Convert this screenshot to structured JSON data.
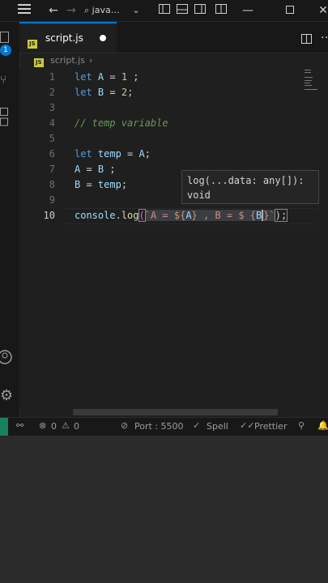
{
  "titlebar": {
    "search_text": "java…"
  },
  "tab": {
    "filename": "script.js",
    "badge": "JS"
  },
  "breadcrumb": {
    "file": "script.js",
    "separator": "›",
    "badge": "JS"
  },
  "editor": {
    "line_numbers": [
      "1",
      "2",
      "3",
      "4",
      "5",
      "6",
      "7",
      "8",
      "9",
      "10"
    ],
    "lines": {
      "l1": {
        "kw": "let",
        "name": "A",
        "op": " = ",
        "num": "1",
        "end": " ;"
      },
      "l2": {
        "kw": "let",
        "name": "B",
        "op": " = ",
        "num": "2",
        "end": ";"
      },
      "l4": {
        "comment": "// temp variable"
      },
      "l6": {
        "kw": "let",
        "name": "temp",
        "op": " = ",
        "val": "A",
        "end": ";"
      },
      "l7": {
        "name": "A",
        "op": " = ",
        "val": "B",
        "end": " ;"
      },
      "l8": {
        "name": "B",
        "op": " = ",
        "val": "temp",
        "end": ";"
      },
      "l10": {
        "obj": "console",
        "dot": ".",
        "fn": "log",
        "open": "(",
        "str1": "`A = ${",
        "v1": "A",
        "str2": "} , B = $ {",
        "v2": "B",
        "str3": "}`",
        "close": ");"
      }
    }
  },
  "tooltip": {
    "line1": "log(...data: any[]):",
    "line2": "void"
  },
  "statusbar": {
    "errors": "0",
    "warnings": "0",
    "port": "Port : 5500",
    "spell": "Spell",
    "prettier": "Prettier"
  },
  "activity": {
    "badge_count": "1"
  },
  "colors": {
    "accent": "#0078d4",
    "remote": "#16825d",
    "keyword": "#569cd6",
    "variable": "#9cdcfe",
    "number": "#b5cea8",
    "comment": "#6a9955",
    "function": "#dcdcaa"
  }
}
